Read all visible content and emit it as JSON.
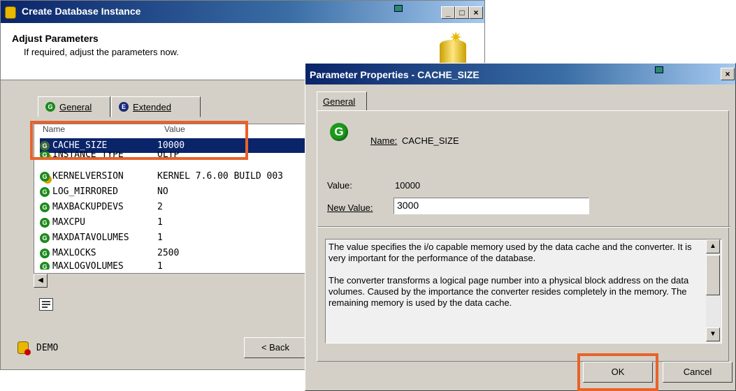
{
  "colors": {
    "accent_orange": "#e8622a",
    "title_blue": "#0a246a",
    "selection": "#0a246a",
    "param_green": "#1c8a1c"
  },
  "main_window": {
    "title": "Create Database Instance",
    "heading": "Adjust Parameters",
    "subheading": "If required, adjust the parameters now.",
    "tabs": [
      {
        "icon": "G",
        "label": "General"
      },
      {
        "icon": "E",
        "label": "Extended"
      }
    ],
    "columns": {
      "name": "Name",
      "value": "Value"
    },
    "rows": [
      {
        "name": "CACHE_SIZE",
        "value": "10000",
        "selected": true
      },
      {
        "name": "INSTANCE_TYPE",
        "value": "OLTP"
      },
      {
        "name": "KERNELVERSION",
        "value": "KERNEL    7.6.00   BUILD 003"
      },
      {
        "name": "LOG_MIRRORED",
        "value": "NO"
      },
      {
        "name": "MAXBACKUPDEVS",
        "value": "2"
      },
      {
        "name": "MAXCPU",
        "value": "1"
      },
      {
        "name": "MAXDATAVOLUMES",
        "value": "1"
      },
      {
        "name": "MAXLOCKS",
        "value": "2500"
      },
      {
        "name": "MAXLOGVOLUMES",
        "value": "1"
      }
    ],
    "instance_name": "DEMO",
    "back_button": "< Back",
    "properties_icon": "properties-icon"
  },
  "dialog": {
    "title": "Parameter Properties - CACHE_SIZE",
    "tab": "General",
    "name_label": "Name:",
    "name_value": "CACHE_SIZE",
    "value_label": "Value:",
    "value": "10000",
    "new_value_label": "New Value:",
    "new_value": "3000",
    "description_p1": "The value specifies the i/o capable memory used by the data cache and the converter. It is very important for the performance of the database.",
    "description_p2": "The converter transforms a logical page number into a physical block address on the data volumes. Caused by the importance the converter resides completely in the memory. The remaining memory is used by the data cache.",
    "ok_button": "OK",
    "cancel_button": "Cancel"
  }
}
